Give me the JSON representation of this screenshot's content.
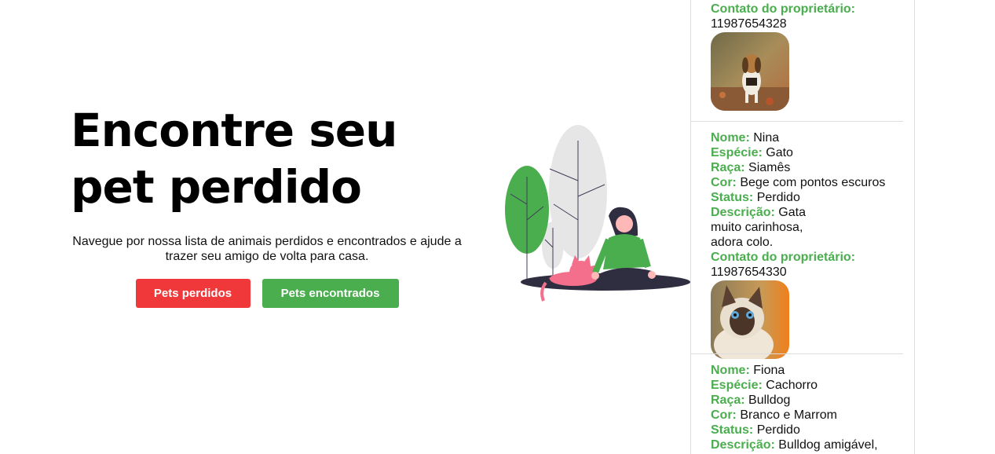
{
  "hero": {
    "title": "Encontre seu pet perdido",
    "description": "Navegue por nossa lista de animais perdidos e encontrados e ajude a trazer seu amigo de volta para casa.",
    "lost_button": "Pets perdidos",
    "found_button": "Pets encontrados"
  },
  "labels": {
    "name": "Nome:",
    "species": "Espécie:",
    "breed": "Raça:",
    "color": "Cor:",
    "status": "Status:",
    "description": "Descrição:",
    "contact": "Contato do proprietário:"
  },
  "pets": [
    {
      "contact": "11987654328",
      "photo_icon": "beagle-photo"
    },
    {
      "name": "Nina",
      "species": "Gato",
      "breed": "Siamês",
      "color": "Bege com pontos escuros",
      "status": "Perdido",
      "description": "Gata muito carinhosa, adora colo.",
      "contact": "11987654330",
      "photo_icon": "siamese-cat-photo"
    },
    {
      "name": "Fiona",
      "species": "Cachorro",
      "breed": "Bulldog",
      "color": "Branco e Marrom",
      "status": "Perdido",
      "description": "Bulldog amigável,"
    }
  ],
  "colors": {
    "accent_green": "#4aae4e",
    "accent_red": "#f0383a",
    "illustration_pink": "#f46f8c"
  }
}
